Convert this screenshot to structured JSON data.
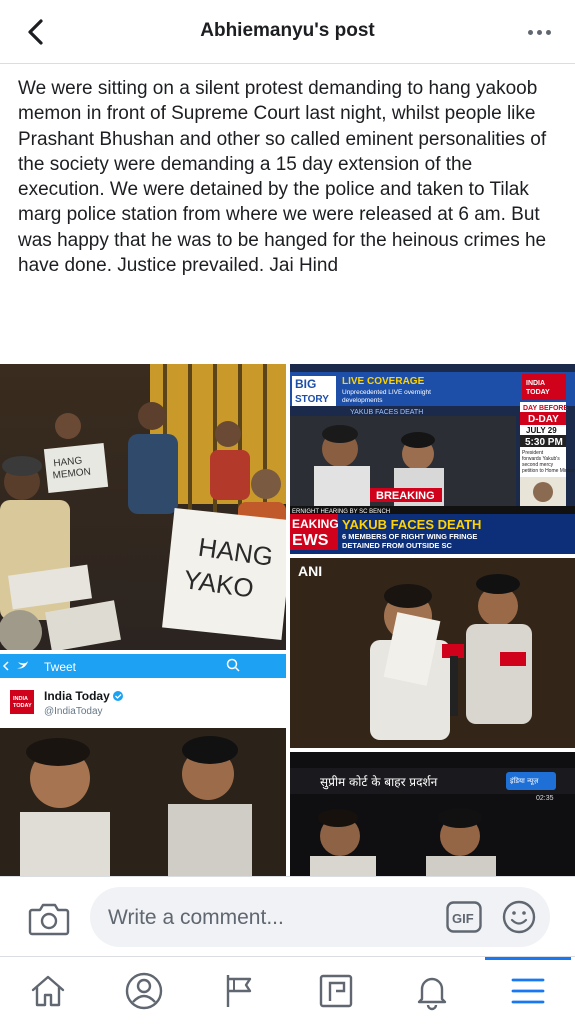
{
  "header": {
    "title": "Abhiemanyu's post"
  },
  "post": {
    "text": "We were sitting on a silent protest demanding to hang yakoob memon in front of Supreme Court last night, whilst people like Prashant Bhushan and other so called eminent personalities of the society were demanding a 15 day extension of the execution. We were detained by the police and taken to Tilak marg police station from where we were released at 6 am. But was happy that he was to be hanged for the heinous crimes he have done. Justice prevailed. Jai Hind"
  },
  "photos": {
    "photo1": {
      "sign_left": "HANG\nMEMON",
      "sign_right": "HANG\nYAKO"
    },
    "photo2": {
      "big_story": "BIG STORY",
      "live_coverage": "LIVE COVERAGE",
      "live_sub": "Unprecedented LIVE overnight developments",
      "yakub_faces_death_small": "YAKUB FACES DEATH",
      "channel": "INDIA TODAY",
      "day_before": "DAY BEFORE",
      "d_day": "D-DAY",
      "july": "JULY 29",
      "time": "5:30 PM",
      "president_note": "President forwards Yakub's second mercy petition to Home Ministry",
      "breaking": "BREAKING",
      "ticker_small": "ERNIGHT HEARING BY SC BENCH",
      "ticker_left": "EAKING\nEWS",
      "headline": "YAKUB FACES DEATH",
      "subheadline": "6 MEMBERS OF RIGHT WING FRINGE\nDETAINED FROM OUTSIDE SC"
    },
    "photo3": {
      "watermark": "ANI"
    },
    "photo4": {
      "tweet_label": "Tweet",
      "account_name": "India Today",
      "account_handle": "@IndiaToday"
    },
    "photo5": {
      "hindi_caption": "सुप्रीम कोर्ट के बाहर प्रदर्शन",
      "channel": "इंडिया न्यूज़",
      "clock": "02:35"
    }
  },
  "comment_bar": {
    "placeholder": "Write a comment..."
  },
  "colors": {
    "accent": "#1877f2",
    "icon_gray": "#606770",
    "tweet_blue": "#1da1f2",
    "breaking_red": "#d0021b"
  },
  "nav": {
    "items": [
      {
        "icon": "home-icon"
      },
      {
        "icon": "profile-icon"
      },
      {
        "icon": "pages-flag-icon"
      },
      {
        "icon": "groups-icon"
      },
      {
        "icon": "notifications-bell-icon"
      },
      {
        "icon": "menu-icon"
      }
    ]
  }
}
